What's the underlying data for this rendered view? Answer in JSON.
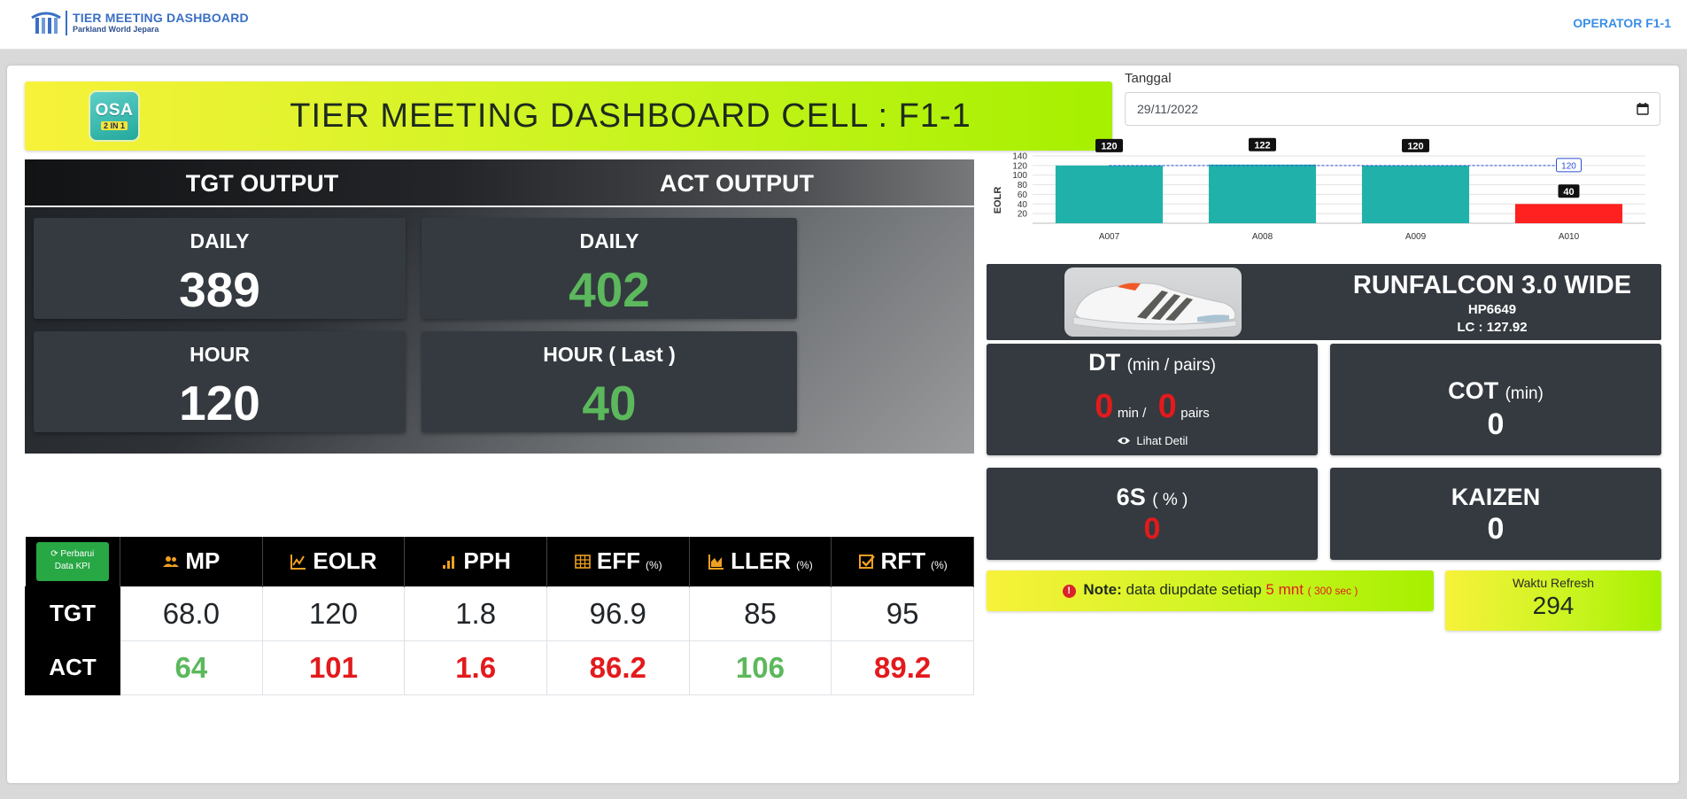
{
  "nav": {
    "brand_title": "TIER MEETING DASHBOARD",
    "brand_subtitle": "Parkland World Jepara",
    "operator": "OPERATOR F1-1"
  },
  "banner": {
    "logo_top": "OSA",
    "logo_bottom": "2 IN 1",
    "title": "TIER MEETING DASHBOARD CELL : F1-1"
  },
  "date": {
    "label": "Tanggal",
    "value": "29/11/2022"
  },
  "output": {
    "tgt_header": "TGT OUTPUT",
    "act_header": "ACT OUTPUT",
    "tgt_daily_label": "DAILY",
    "tgt_daily_value": "389",
    "act_daily_label": "DAILY",
    "act_daily_value": "402",
    "tgt_hour_label": "HOUR",
    "tgt_hour_value": "120",
    "act_hour_label": "HOUR ( Last )",
    "act_hour_value": "40"
  },
  "kpi": {
    "refresh_button": [
      "Perbarui",
      "Data KPI"
    ],
    "columns": [
      {
        "label": "MP",
        "unit": ""
      },
      {
        "label": "EOLR",
        "unit": ""
      },
      {
        "label": "PPH",
        "unit": ""
      },
      {
        "label": "EFF",
        "unit": "(%)"
      },
      {
        "label": "LLER",
        "unit": "(%)"
      },
      {
        "label": "RFT",
        "unit": "(%)"
      }
    ],
    "rows": [
      {
        "label": "TGT",
        "values": [
          "68.0",
          "120",
          "1.8",
          "96.9",
          "85",
          "95"
        ],
        "colors": [
          "",
          "",
          "",
          "",
          "",
          ""
        ]
      },
      {
        "label": "ACT",
        "values": [
          "64",
          "101",
          "1.6",
          "86.2",
          "106",
          "89.2"
        ],
        "colors": [
          "green",
          "red",
          "red",
          "red",
          "green",
          "red"
        ]
      }
    ]
  },
  "chart_data": {
    "type": "bar",
    "categories": [
      "A007",
      "A008",
      "A009",
      "A010"
    ],
    "values": [
      120,
      122,
      120,
      40
    ],
    "bar_colors": [
      "#20b2aa",
      "#20b2aa",
      "#20b2aa",
      "#ff2020"
    ],
    "target_line": 120,
    "target_label": "120",
    "ylabel": "EOLR",
    "yticks": [
      20,
      40,
      60,
      80,
      100,
      120,
      140
    ],
    "ylim": [
      0,
      140
    ],
    "grid": true
  },
  "product": {
    "name": "RUNFALCON 3.0 WIDE",
    "code": "HP6649",
    "lc": "LC : 127.92"
  },
  "dt": {
    "title": "DT",
    "unit": "(min / pairs)",
    "min_value": "0",
    "min_unit": "min /",
    "pairs_value": "0",
    "pairs_unit": "pairs",
    "link": "Lihat Detil"
  },
  "cot": {
    "title": "COT",
    "unit": "(min)",
    "value": "0"
  },
  "six_s": {
    "title": "6S",
    "unit": "( % )",
    "value": "0"
  },
  "kaizen": {
    "title": "KAIZEN",
    "value": "0"
  },
  "note": {
    "label": "Note:",
    "text": "data diupdate setiap",
    "interval": "5 mnt",
    "seconds": "( 300 sec )"
  },
  "refresh_timer": {
    "label": "Waktu Refresh",
    "value": "294"
  }
}
